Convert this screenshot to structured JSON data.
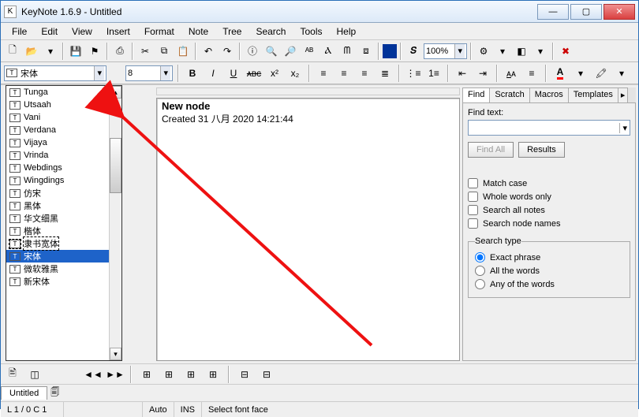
{
  "window": {
    "title": "KeyNote 1.6.9 - Untitled"
  },
  "menu": [
    "File",
    "Edit",
    "View",
    "Insert",
    "Format",
    "Note",
    "Tree",
    "Search",
    "Tools",
    "Help"
  ],
  "font": {
    "current": "宋体",
    "size": "8",
    "zoom": "100%"
  },
  "fontlist": [
    "Tunga",
    "Utsaah",
    "Vani",
    "Verdana",
    "Vijaya",
    "Vrinda",
    "Webdings",
    "Wingdings",
    "仿宋",
    "黑体",
    "华文细黑",
    "楷体",
    "隶书宽体",
    "宋体",
    "微软雅黑",
    "新宋体"
  ],
  "fontlist_selected_index": 13,
  "fontlist_boxed_index": 12,
  "note": {
    "title": "New node",
    "created": "Created 31 八月 2020 14:21:44"
  },
  "rtabs": [
    "Find",
    "Scratch",
    "Macros",
    "Templates"
  ],
  "find": {
    "label": "Find text:",
    "findall": "Find All",
    "results": "Results",
    "opts": [
      "Match case",
      "Whole words only",
      "Search all notes",
      "Search node names"
    ],
    "stype_legend": "Search type",
    "stype": [
      "Exact phrase",
      "All the words",
      "Any of the words"
    ]
  },
  "filetab": "Untitled",
  "status": {
    "pos": "L 1 / 0  C 1",
    "auto": "Auto",
    "ins": "INS",
    "hint": "Select font face"
  }
}
